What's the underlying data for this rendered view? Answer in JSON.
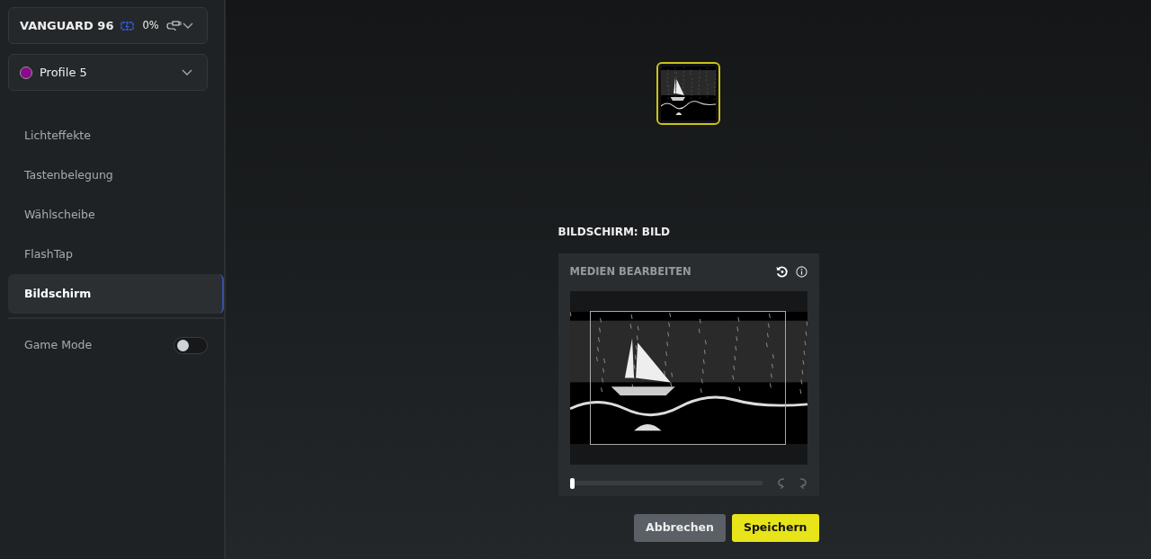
{
  "device": {
    "name": "VANGUARD 96",
    "battery": "0%"
  },
  "profile": {
    "name": "Profile 5",
    "color": "#8b0a8b"
  },
  "nav": [
    {
      "label": "Lichteffekte",
      "selected": false
    },
    {
      "label": "Tastenbelegung",
      "selected": false
    },
    {
      "label": "Wählscheibe",
      "selected": false
    },
    {
      "label": "FlashTap",
      "selected": false
    },
    {
      "label": "Bildschirm",
      "selected": true
    }
  ],
  "game_mode": {
    "label": "Game Mode",
    "on": false
  },
  "section_title": "BILDSCHIRM: BILD",
  "editor": {
    "title": "MEDIEN BEARBEITEN",
    "zoom_slider": {
      "level": 0.01
    }
  },
  "buttons": [
    {
      "label": "Abbrechen",
      "kind": "secondary"
    },
    {
      "label": "Speichern",
      "kind": "primary"
    }
  ]
}
